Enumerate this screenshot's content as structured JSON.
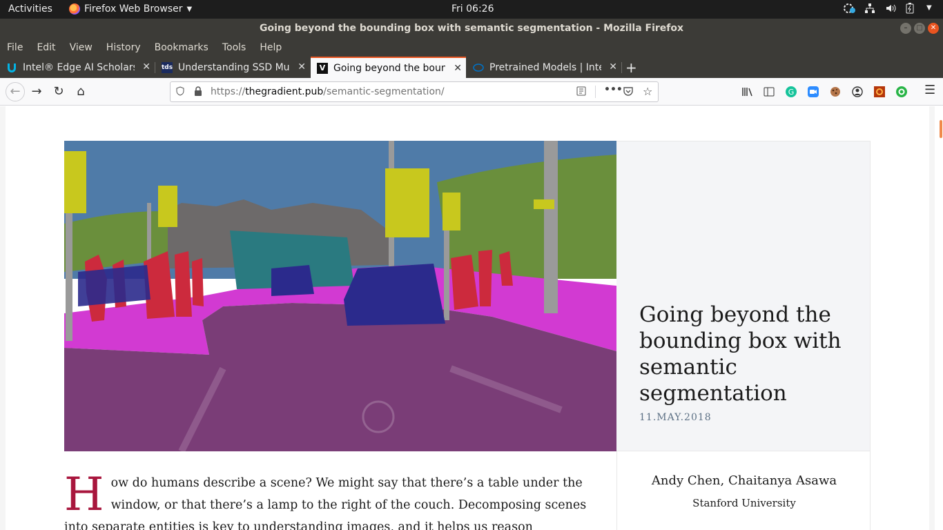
{
  "system": {
    "activities": "Activities",
    "app_name": "Firefox Web Browser",
    "clock": "Fri 06:26"
  },
  "window": {
    "title": "Going beyond the bounding box with semantic segmentation - Mozilla Firefox"
  },
  "menu": [
    "File",
    "Edit",
    "View",
    "History",
    "Bookmarks",
    "Tools",
    "Help"
  ],
  "tabs": [
    {
      "label": "Intel® Edge AI Scholarsh",
      "active": false
    },
    {
      "label": "Understanding SSD Mult",
      "active": false
    },
    {
      "label": "Going beyond the bound",
      "active": true
    },
    {
      "label": "Pretrained Models | Intel",
      "active": false
    }
  ],
  "address": {
    "prefix": "https://",
    "host": "thegradient.pub",
    "path": "/semantic-segmentation/"
  },
  "article": {
    "title": "Going beyond the bounding box with semantic segmentation",
    "date": "11.MAY.2018",
    "authors": "Andy Chen, Chaitanya Asawa",
    "affiliation": "Stanford University",
    "dropcap": "H",
    "body": "ow do humans describe a scene? We might say that there’s a table under the window, or that there’s a lamp to the right of the couch. Decomposing scenes into separate entities is key to understanding images, and it helps us reason"
  },
  "colors": {
    "accent_tab": "#e95420",
    "dropcap": "#a8163d",
    "date": "#5d7185"
  }
}
